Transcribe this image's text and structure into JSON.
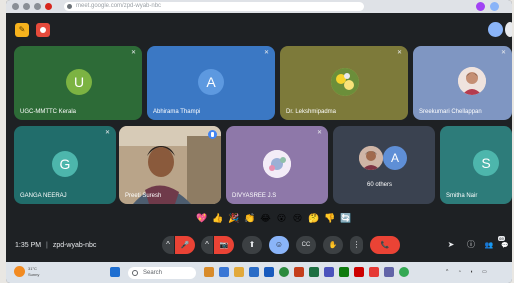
{
  "browser": {
    "url": "meet.google.com/zpd-wyab-nbc"
  },
  "meet": {
    "time": "1:35 PM",
    "separator": "|",
    "meeting_code": "zpd-wyab-nbc",
    "colors": {
      "background": "#1e2124",
      "control": "#3c4043",
      "danger": "#ea4335",
      "accent": "#8ab4f8"
    }
  },
  "tiles": [
    {
      "name": "UGC-MMTTC Kerala",
      "avatar_letter": "U",
      "tile_color": "#2d6b37",
      "avatar_color": "#7cb342",
      "muted": true
    },
    {
      "name": "Abhirama Thampi",
      "avatar_letter": "A",
      "tile_color": "#3b78c4",
      "avatar_color": "#5d99e0",
      "muted": true
    },
    {
      "name": "Dr. Lekshmipadma",
      "avatar_letter": "",
      "tile_color": "#7d7a3a",
      "avatar_color": "#c9c46a",
      "muted": true,
      "photo": true
    },
    {
      "name": "Sreekumari Chellappan",
      "avatar_letter": "",
      "tile_color": "#7f96c2",
      "avatar_color": "#d9b8a6",
      "muted": true,
      "photo": true
    },
    {
      "name": "GANGA NEERAJ",
      "avatar_letter": "G",
      "tile_color": "#216d6b",
      "avatar_color": "#4db6ac",
      "muted": true
    },
    {
      "name": "Preeti Suresh",
      "avatar_letter": "",
      "tile_color": "#b9a489",
      "avatar_color": "",
      "muted": false,
      "video": true
    },
    {
      "name": "DIVYASREE J.S",
      "avatar_letter": "",
      "tile_color": "#8e78a9",
      "avatar_color": "#e4d6ee",
      "muted": true,
      "photo": true
    },
    {
      "name": "60 others",
      "avatar_letter": "A",
      "tile_color": "#3a4250",
      "avatar_color": "#5f8fd6",
      "muted": false
    },
    {
      "name": "Smitha Nair",
      "avatar_letter": "S",
      "tile_color": "#2d7c7a",
      "avatar_color": "#4db6ac",
      "muted": true
    }
  ],
  "reactions": [
    "💖",
    "👍",
    "🎉",
    "👏",
    "😂",
    "😮",
    "😢",
    "🤔",
    "👎",
    "🔄"
  ],
  "controls": {
    "mic": "🎤",
    "camera": "📷",
    "present": "⬆",
    "emoji": "☺",
    "captions": "CC",
    "raise_hand": "✋",
    "more": "⋮",
    "leave": "📞"
  },
  "right_icons": {
    "info": "ⓘ",
    "people": "👥",
    "participants_count": "69",
    "chat": "💬",
    "activities": "◈"
  },
  "taskbar": {
    "search_label": "Search",
    "weather_temp": "31°C",
    "weather_text": "Sunny"
  }
}
